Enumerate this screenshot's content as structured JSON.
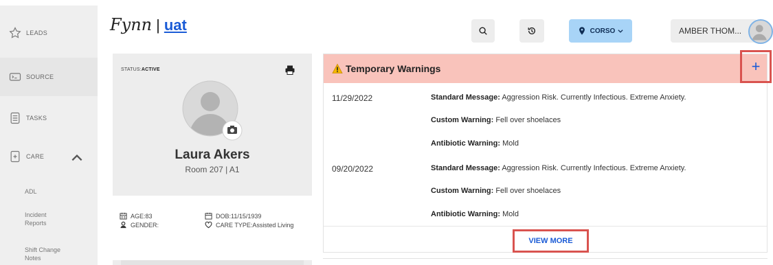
{
  "sidebar": {
    "items": [
      {
        "label": "LEADS",
        "icon": "star-icon"
      },
      {
        "label": "SOURCE",
        "icon": "source-icon"
      },
      {
        "label": "TASKS",
        "icon": "tasks-icon"
      },
      {
        "label": "CARE",
        "icon": "care-icon"
      }
    ],
    "care_subitems": [
      {
        "label": "ADL"
      },
      {
        "label": "Incident Reports"
      },
      {
        "label": "Shift Change Notes"
      }
    ]
  },
  "header": {
    "brand": "Fynn",
    "separator": "|",
    "environment": "uat",
    "location_label": "CORSO",
    "user_name": "AMBER THOM..."
  },
  "profile": {
    "status_label": "STATUS:",
    "status_value": "ACTIVE",
    "name": "Laura Akers",
    "room": "Room 207 | A1",
    "age": "AGE:83",
    "gender": "GENDER:",
    "dob": "DOB:11/15/1939",
    "care_type": "CARE TYPE:Assisted Living"
  },
  "warnings": {
    "title": "Temporary Warnings",
    "add_label": "+",
    "entries": [
      {
        "date": "11/29/2022",
        "standard_label": "Standard Message:",
        "standard_value": "Aggression Risk. Currently Infectious. Extreme Anxiety.",
        "custom_label": "Custom Warning:",
        "custom_value": "Fell over shoelaces",
        "antibiotic_label": "Antibiotic Warning:",
        "antibiotic_value": "Mold"
      },
      {
        "date": "09/20/2022",
        "standard_label": "Standard Message:",
        "standard_value": "Aggression Risk. Currently Infectious. Extreme Anxiety.",
        "custom_label": "Custom Warning:",
        "custom_value": "Fell over shoelaces",
        "antibiotic_label": "Antibiotic Warning:",
        "antibiotic_value": "Mold"
      }
    ],
    "view_more_label": "VIEW MORE"
  },
  "colors": {
    "accent": "#1a5bd6",
    "warning_header": "#f9c3bb",
    "highlight_box": "#d9534f",
    "location_button": "#a8d4f7"
  }
}
